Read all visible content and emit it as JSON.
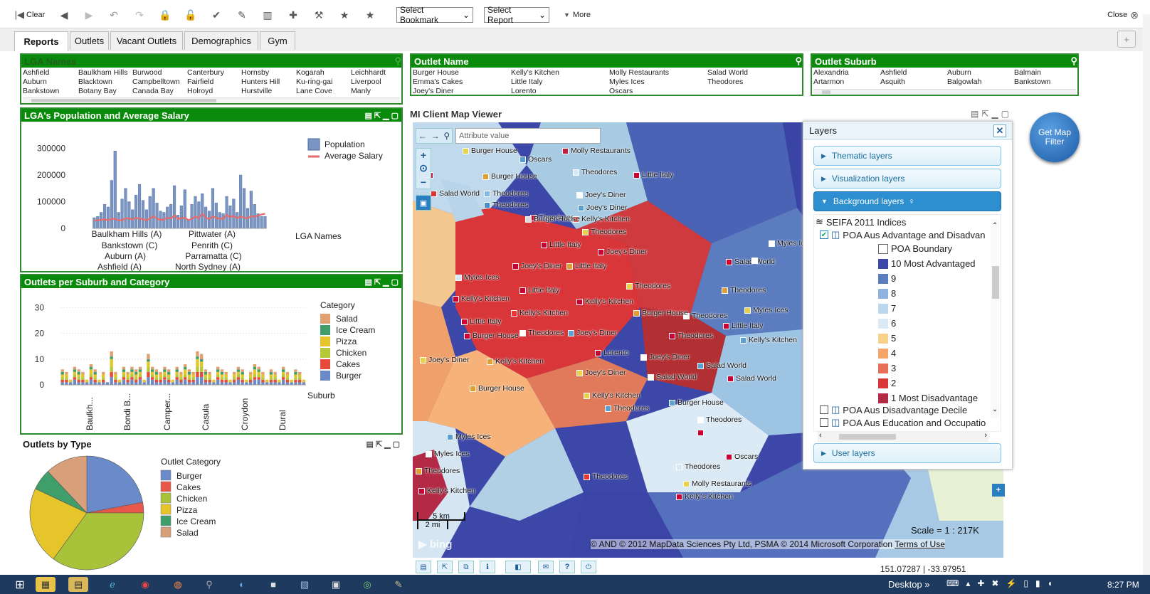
{
  "toolbar": {
    "clear_label": "Clear",
    "bookmark_select": "Select Bookmark",
    "report_select": "Select Report",
    "more_label": "More",
    "close_label": "Close"
  },
  "tabs": [
    "Reports",
    "Outlets",
    "Vacant Outlets",
    "Demographics",
    "Gym"
  ],
  "lga_names": {
    "title": "LGA Names",
    "items": [
      "Ashfield",
      "Baulkham Hills",
      "Burwood",
      "Canterbury",
      "Hornsby",
      "Kogarah",
      "Leichhardt",
      "Auburn",
      "Blacktown",
      "Campbelltown",
      "Fairfield",
      "Hunters Hill",
      "Ku-ring-gai",
      "Liverpool",
      "Bankstown",
      "Botany Bay",
      "Canada Bay",
      "Holroyd",
      "Hurstville",
      "Lane Cove",
      "Manly"
    ]
  },
  "outlet_name": {
    "title": "Outlet Name",
    "items": [
      "Burger House",
      "Kelly's Kitchen",
      "Molly Restaurants",
      "Salad World",
      "Emma's Cakes",
      "Little Italy",
      "Myles Ices",
      "Theodores",
      "Joey's Diner",
      "Lorento",
      "Oscars",
      ""
    ]
  },
  "outlet_suburb": {
    "title": "Outlet Suburb",
    "items": [
      "Alexandria",
      "Ashfield",
      "Auburn",
      "Balmain",
      "Artarmon",
      "Asquith",
      "Balgowlah",
      "Bankstown"
    ]
  },
  "pop_chart": {
    "title": "LGA's Population and Average Salary",
    "legend": [
      "Population",
      "Average Salary"
    ],
    "xlabel": "LGA Names",
    "yticks": [
      "300000",
      "200000",
      "100000",
      "0"
    ],
    "xlabels": [
      "Baulkham Hills (A)",
      "Bankstown (C)",
      "Auburn (A)",
      "Ashfield (A)",
      "Pittwater (A)",
      "Penrith (C)",
      "Parramatta (C)",
      "North Sydney (A)"
    ]
  },
  "outlets_chart": {
    "title": "Outlets per Suburb and Category",
    "legend_title": "Category",
    "legend": [
      "Salad",
      "Ice Cream",
      "Pizza",
      "Chicken",
      "Cakes",
      "Burger"
    ],
    "xlabel": "Suburb",
    "yticks": [
      "30",
      "20",
      "10",
      "0"
    ],
    "xlabels": [
      "Baulkh...",
      "Bondi B...",
      "Camper...",
      "Casula",
      "Croydon",
      "Dural"
    ]
  },
  "type_chart": {
    "title": "Outlets by Type",
    "legend_title": "Outlet Category",
    "legend": [
      "Burger",
      "Cakes",
      "Chicken",
      "Pizza",
      "Ice Cream",
      "Salad"
    ]
  },
  "map": {
    "title": "MI Client Map Viewer",
    "attribute_placeholder": "Attribute value",
    "get_filter": "Get Map Filter",
    "scale_km": "5 km",
    "scale_mi": "2 mi",
    "scale_text": "Scale = 1 : 217K",
    "copyright": "© AND © 2012 MapData Sciences Pty Ltd, PSMA © 2014 Microsoft Corporation",
    "terms": "Terms of Use",
    "coords": "151.07287 | -33.97951",
    "bing": "bing"
  },
  "layers": {
    "title": "Layers",
    "thematic": "Thematic layers",
    "visualization": "Visualization layers",
    "background": "Background layers",
    "group": "SEIFA 2011 Indices",
    "active_layer": "POA Aus Advantage and Disadvan",
    "legend": [
      "POA Boundary",
      "10 Most Advantaged",
      "9",
      "8",
      "7",
      "6",
      "5",
      "4",
      "3",
      "2",
      "1 Most Disadvantage"
    ],
    "other1": "POA Aus Disadvantage Decile",
    "other2": "POA Aus Education and Occupatio",
    "user": "User layers"
  },
  "taskbar": {
    "desktop": "Desktop",
    "time": "8:27 PM"
  },
  "chart_data": [
    {
      "type": "bar",
      "title": "LGA's Population and Average Salary",
      "xlabel": "LGA Names",
      "ylim": [
        0,
        320000
      ],
      "series": [
        {
          "name": "Population",
          "values": [
            40000,
            45000,
            60000,
            90000,
            80000,
            180000,
            290000,
            60000,
            110000,
            150000,
            100000,
            70000,
            125000,
            165000,
            105000,
            70000,
            120000,
            150000,
            95000,
            65000,
            60000,
            80000,
            90000,
            160000,
            50000,
            85000,
            145000,
            30000,
            90000,
            120000,
            100000,
            130000,
            80000,
            65000,
            150000,
            95000,
            60000,
            55000,
            120000,
            85000,
            110000,
            60000,
            200000,
            150000,
            75000,
            140000,
            90000,
            55000,
            45000,
            45000
          ]
        },
        {
          "name": "Average Salary",
          "values": [
            30000,
            30000,
            32000,
            34000,
            30000,
            36000,
            35000,
            31000,
            30000,
            38000,
            37000,
            33000,
            40000,
            36000,
            34000,
            30000,
            38000,
            45000,
            35000,
            32000,
            33000,
            40000,
            37000,
            48000,
            35000,
            38000,
            40000,
            31000,
            36000,
            44000,
            38000,
            55000,
            40000,
            35000,
            45000,
            39000,
            36000,
            37000,
            50000,
            42000,
            47000,
            38000,
            44000,
            40000,
            38000,
            46000,
            44000,
            48000,
            52000,
            55000
          ]
        }
      ]
    },
    {
      "type": "bar",
      "title": "Outlets per Suburb and Category",
      "xlabel": "Suburb",
      "ylim": [
        0,
        32
      ],
      "categories": [
        "Baulkh...",
        "Bondi B...",
        "Camper...",
        "Casula",
        "Croydon",
        "Dural"
      ],
      "series": [
        {
          "name": "Salad",
          "values": [
            2,
            1,
            1,
            2,
            1,
            1
          ]
        },
        {
          "name": "Ice Cream",
          "values": [
            1,
            2,
            1,
            2,
            1,
            1
          ]
        },
        {
          "name": "Pizza",
          "values": [
            2,
            3,
            2,
            3,
            2,
            1
          ]
        },
        {
          "name": "Chicken",
          "values": [
            1,
            2,
            1,
            2,
            1,
            1
          ]
        },
        {
          "name": "Cakes",
          "values": [
            1,
            2,
            1,
            2,
            1,
            1
          ]
        },
        {
          "name": "Burger",
          "values": [
            2,
            3,
            2,
            2,
            1,
            1
          ]
        }
      ]
    },
    {
      "type": "pie",
      "title": "Outlets by Type",
      "categories": [
        "Burger",
        "Cakes",
        "Chicken",
        "Pizza",
        "Ice Cream",
        "Salad"
      ],
      "values": [
        22,
        3,
        35,
        22,
        6,
        12
      ]
    }
  ]
}
